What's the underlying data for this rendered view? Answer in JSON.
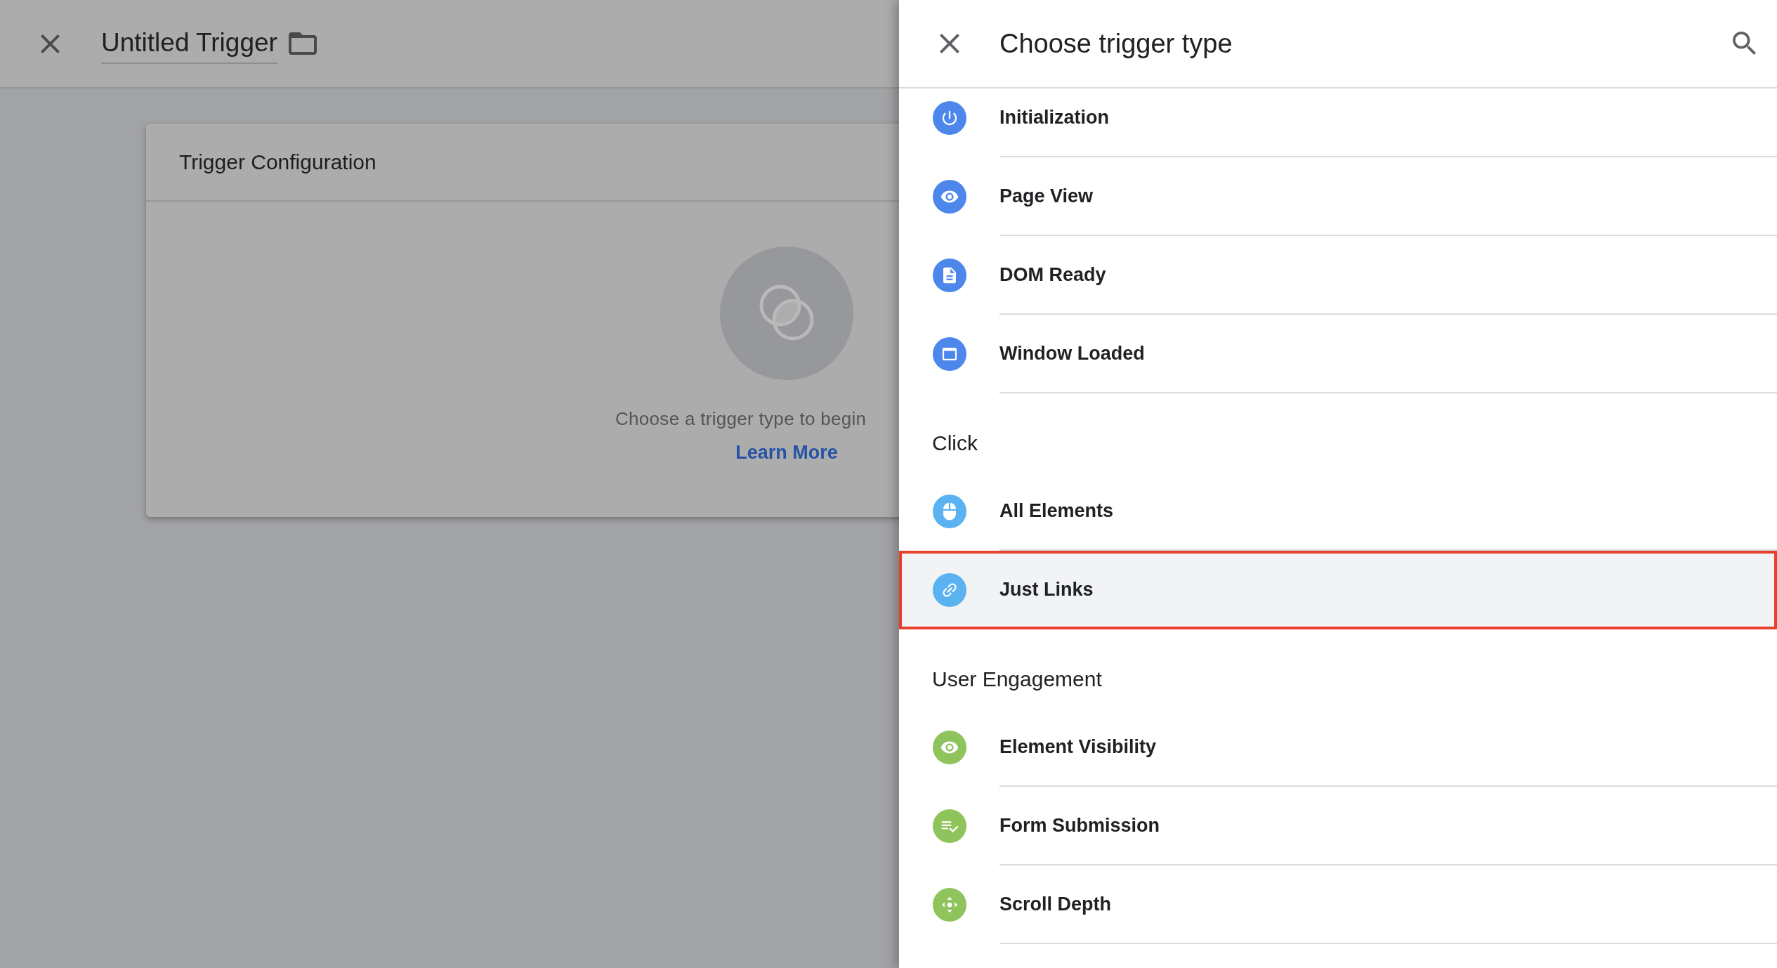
{
  "editor": {
    "title": "Untitled Trigger",
    "card": {
      "title": "Trigger Configuration",
      "prompt": "Choose a trigger type to begin",
      "link": "Learn More"
    }
  },
  "panel": {
    "title": "Choose trigger type",
    "sections": [
      {
        "items": [
          {
            "label": "Initialization",
            "kind": "power",
            "color": "#4d87ec",
            "selected": false
          },
          {
            "label": "Page View",
            "kind": "eye",
            "color": "#4d87ec",
            "selected": false
          },
          {
            "label": "DOM Ready",
            "kind": "document",
            "color": "#4d87ec",
            "selected": false
          },
          {
            "label": "Window Loaded",
            "kind": "window",
            "color": "#4d87ec",
            "selected": false
          }
        ]
      },
      {
        "heading": "Click",
        "items": [
          {
            "label": "All Elements",
            "kind": "mouse",
            "color": "#5bb2f0",
            "selected": false
          },
          {
            "label": "Just Links",
            "kind": "link",
            "color": "#5bb2f0",
            "selected": true
          }
        ]
      },
      {
        "heading": "User Engagement",
        "items": [
          {
            "label": "Element Visibility",
            "kind": "eye",
            "color": "#8fc35b",
            "selected": false
          },
          {
            "label": "Form Submission",
            "kind": "checklist",
            "color": "#8fc35b",
            "selected": false
          },
          {
            "label": "Scroll Depth",
            "kind": "move",
            "color": "#8fc35b",
            "selected": false
          }
        ]
      }
    ]
  }
}
